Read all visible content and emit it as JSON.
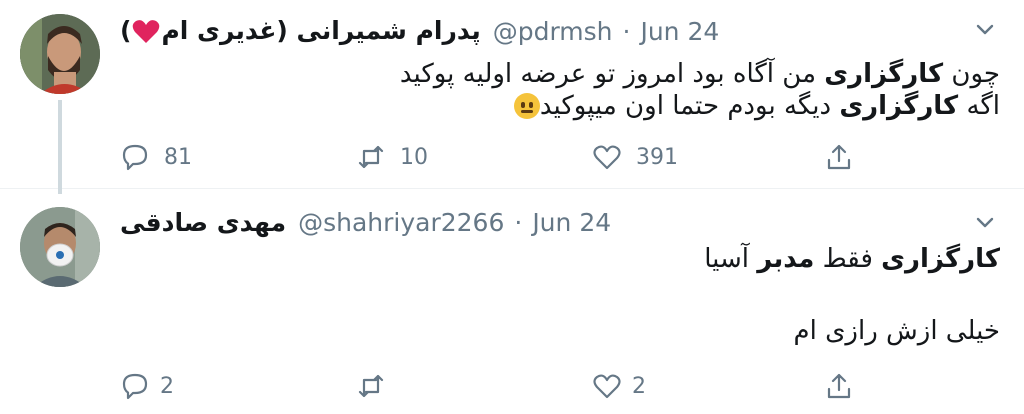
{
  "colors": {
    "text": "#14171a",
    "secondary": "#657786",
    "thread_line": "#cfd9de",
    "heart": "#e0245e"
  },
  "tweets": [
    {
      "name": "پدرام شمیرانی (غدیری ام",
      "name_suffix": ")",
      "name_emoji": "red-heart-icon",
      "handle": "@pdrmsh",
      "separator": "·",
      "date": "Jun 24",
      "lines": [
        {
          "prefix": "چون ",
          "bold": "کارگزاری",
          "suffix": " من آگاه بود امروز تو عرضه اولیه پوکید"
        },
        {
          "prefix": "اگه ",
          "bold": "کارگزاری",
          "suffix": " دیگه بودم حتما اون میپوکید",
          "emoji": "neutral-face-icon"
        }
      ],
      "counts": {
        "replies": "81",
        "retweets": "10",
        "likes": "391"
      }
    },
    {
      "name": "مهدی صادقی",
      "handle": "@shahriyar2266",
      "separator": "·",
      "date": "Jun 24",
      "paragraphs": [
        {
          "bold1": "کارگزاری",
          "mid": " فقط ",
          "bold2": "مدبر",
          "suffix": " آسیا"
        },
        {
          "text": "خیلی ازش رازی ام"
        }
      ],
      "counts": {
        "replies": "2",
        "retweets": "",
        "likes": "2"
      }
    }
  ]
}
